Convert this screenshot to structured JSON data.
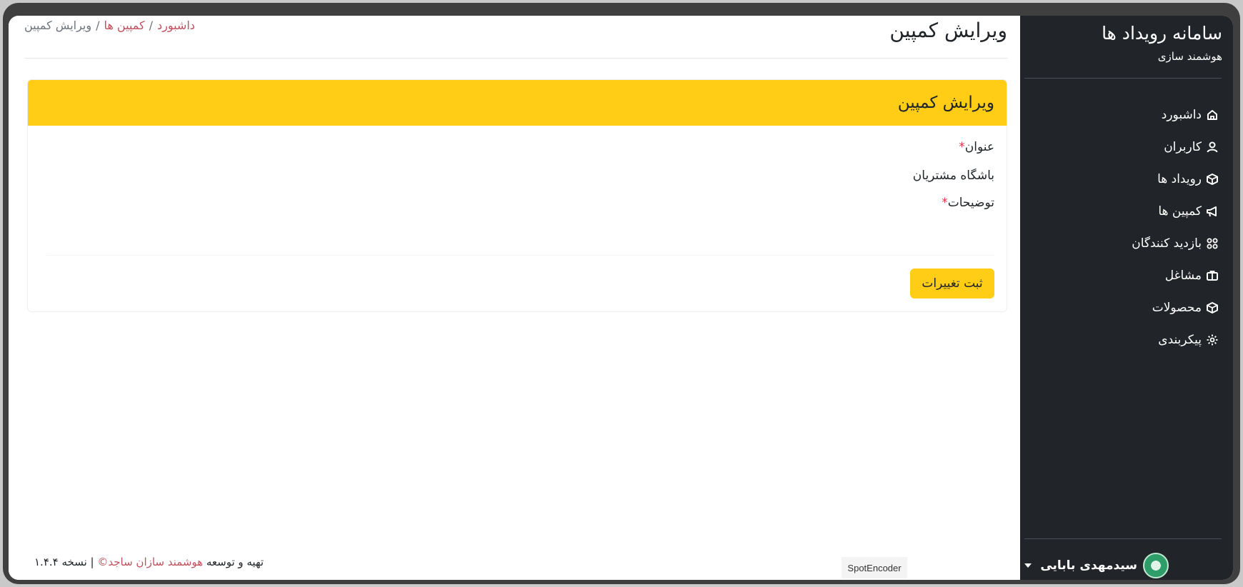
{
  "app": {
    "title": "سامانه رویداد ها",
    "subtitle": "هوشمند سازی"
  },
  "sidebar": {
    "items": [
      {
        "label": "داشبورد",
        "icon": "home-icon"
      },
      {
        "label": "کاربران",
        "icon": "user-icon"
      },
      {
        "label": "رویداد ها",
        "icon": "box-icon"
      },
      {
        "label": "کمپین ها",
        "icon": "megaphone-icon"
      },
      {
        "label": "بازدید کنندگان",
        "icon": "people-icon"
      },
      {
        "label": "مشاغل",
        "icon": "briefcase-icon"
      },
      {
        "label": "محصولات",
        "icon": "package-icon"
      },
      {
        "label": "پیکربندی",
        "icon": "gear-icon"
      }
    ],
    "user_name": "سیدمهدی بابایی"
  },
  "page": {
    "title": "ویرایش کمپین"
  },
  "breadcrumb": {
    "home": "داشبورد",
    "separator": "/",
    "campaigns": "کمپین ها",
    "current": "ویرایش کمپین"
  },
  "form": {
    "header": "ویرایش کمپین",
    "title_label": "عنوان",
    "title_value": "باشگاه مشتریان",
    "description_label": "توضیحات",
    "required_mark": "*",
    "submit_label": "ثبت تغییرات"
  },
  "footer": {
    "prefix": "تهیه و توسعه",
    "company": "هوشمند سازان ساجد©",
    "version_text": "| نسخه ۱.۴.۴"
  },
  "watermark": "SpotEncoder",
  "colors": {
    "accent": "#ffcd15",
    "sidebar_bg": "#212529",
    "link": "#c0505d"
  }
}
